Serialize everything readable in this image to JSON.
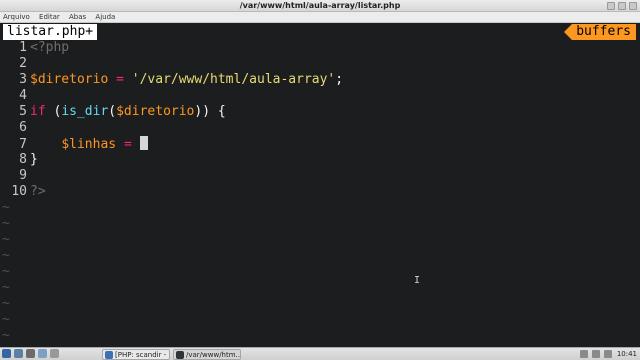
{
  "window": {
    "title": "/var/www/html/aula-array/listar.php"
  },
  "menu": [
    "Arquivo",
    "Editar",
    "Abas",
    "Ajuda"
  ],
  "vim": {
    "active_tab": "listar.php+",
    "buffers_label": "buffers",
    "lines": [
      {
        "num": "1",
        "tokens": [
          [
            "tk-tag",
            "<?php"
          ]
        ]
      },
      {
        "num": "2",
        "tokens": []
      },
      {
        "num": "3",
        "tokens": [
          [
            "tk-var",
            "$diretorio"
          ],
          [
            "",
            " "
          ],
          [
            "tk-op",
            "="
          ],
          [
            "",
            " "
          ],
          [
            "tk-str",
            "'/var/www/html/aula-array'"
          ],
          [
            "",
            ";"
          ]
        ]
      },
      {
        "num": "4",
        "tokens": []
      },
      {
        "num": "5",
        "tokens": [
          [
            "tk-kw",
            "if"
          ],
          [
            "",
            " ("
          ],
          [
            "tk-fn",
            "is_dir"
          ],
          [
            "",
            "("
          ],
          [
            "tk-var",
            "$diretorio"
          ],
          [
            "",
            ")) {"
          ]
        ]
      },
      {
        "num": "6",
        "tokens": []
      },
      {
        "num": "7",
        "tokens": [
          [
            "",
            "    "
          ],
          [
            "tk-var",
            "$linhas"
          ],
          [
            "",
            " "
          ],
          [
            "tk-op",
            "="
          ],
          [
            "",
            " "
          ]
        ],
        "cursor": true
      },
      {
        "num": "8",
        "tokens": [
          [
            "",
            "}"
          ]
        ]
      },
      {
        "num": "9",
        "tokens": []
      },
      {
        "num": "10",
        "tokens": [
          [
            "tk-tag",
            "?>"
          ]
        ]
      }
    ],
    "tilde_count": 9,
    "tilde_char": "~"
  },
  "taskbar": {
    "tasks": [
      {
        "label": "[PHP: scandir - ...",
        "icon_color": "#3b6fb6"
      },
      {
        "label": "/var/www/htm...",
        "icon_color": "#2e3436"
      }
    ],
    "clock": "10:41"
  },
  "colors": {
    "background": "#1b1d1e",
    "variable": "#fd971f",
    "operator_keyword": "#f92672",
    "string": "#e6db74",
    "function": "#66d9ef",
    "php_tag": "#6e6e6e",
    "buffers_accent": "#fd971f"
  }
}
